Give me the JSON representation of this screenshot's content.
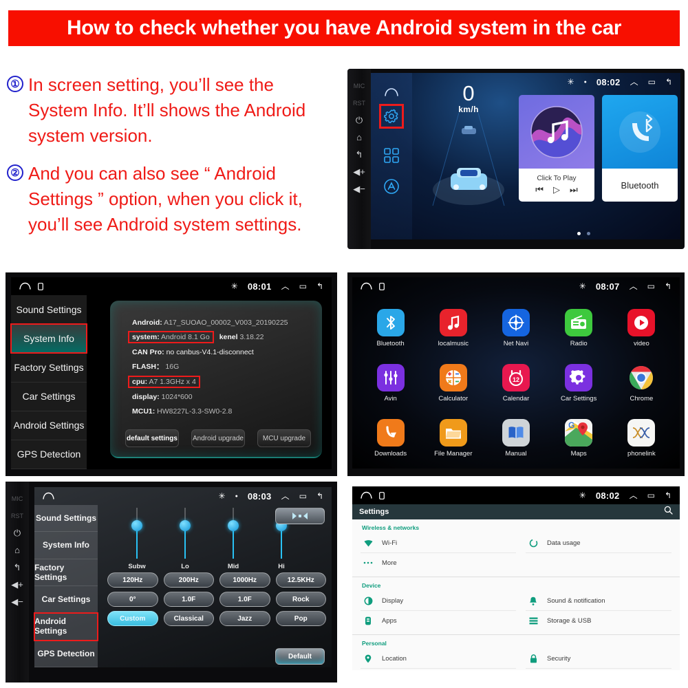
{
  "banner": {
    "title": "How to check whether you have Android system in the car"
  },
  "instructions": [
    {
      "num": "①",
      "text": "In screen setting, you’ll see the System Info. It’ll shows the Android system version."
    },
    {
      "num": "②",
      "text": "And you can also see “ Android Settings ” option, when you click it, you’ll see Android system settings."
    }
  ],
  "colors": {
    "banner_bg": "#f80f00",
    "instruction_text": "#ef1b17",
    "number_circle": "#2222cc",
    "highlight_box": "#ee1b1b",
    "accent_teal": "#0f9d7e",
    "accent_cyan": "#29c2f5"
  },
  "hardware_buttons": [
    {
      "label": "MIC",
      "type": "text"
    },
    {
      "label": "RST",
      "type": "text"
    },
    {
      "label": "⏻",
      "type": "glyph",
      "name": "power-button"
    },
    {
      "label": "⌂",
      "type": "glyph",
      "name": "home-button"
    },
    {
      "label": "↰",
      "type": "glyph",
      "name": "back-button"
    },
    {
      "label": "◀+",
      "type": "glyph",
      "name": "volume-up-button"
    },
    {
      "label": "◀−",
      "type": "glyph",
      "name": "volume-down-button"
    }
  ],
  "home_screen": {
    "status": {
      "bluetooth": "✳",
      "dot": "●",
      "clock": "08:02",
      "up": "︿",
      "recents": "▭",
      "back": "↰"
    },
    "launcher_icons": [
      "home-icon",
      "gear-icon",
      "apps-grid-icon",
      "assistant-icon"
    ],
    "gear_highlighted": true,
    "speed": {
      "value": "0",
      "unit": "km/h"
    },
    "cards": [
      {
        "name": "music",
        "label": "Click To Play",
        "controls": [
          "⏮",
          "▷",
          "⏭"
        ]
      },
      {
        "name": "bluetooth",
        "label": "Bluetooth"
      }
    ],
    "page_dots": 2,
    "active_dot": 0
  },
  "system_info": {
    "status": {
      "bluetooth": "✳",
      "clock": "08:01"
    },
    "menu": [
      {
        "label": "Sound Settings",
        "active": false,
        "highlighted": false
      },
      {
        "label": "System Info",
        "active": true,
        "highlighted": true
      },
      {
        "label": "Factory Settings",
        "active": false,
        "highlighted": false
      },
      {
        "label": "Car Settings",
        "active": false,
        "highlighted": false
      },
      {
        "label": "Android Settings",
        "active": false,
        "highlighted": false
      },
      {
        "label": "GPS Detection",
        "active": false,
        "highlighted": false
      }
    ],
    "rows": [
      {
        "key": "Android:",
        "value": "A17_SUOAO_00002_V003_20190225",
        "boxed": false
      },
      {
        "key": "system:",
        "value": "Android 8.1 Go",
        "key2": "kenel",
        "value2": "3.18.22",
        "boxed": true
      },
      {
        "key": "CAN Pro:",
        "value": "no canbus-V4.1-disconnect",
        "boxed": false
      },
      {
        "key": "FLASH：",
        "value": "16G",
        "boxed": false
      },
      {
        "key": "cpu:",
        "value": "A7 1.3GHz x 4",
        "boxed": true
      },
      {
        "key": "display:",
        "value": "1024*600",
        "boxed": false
      },
      {
        "key": "MCU1:",
        "value": "HW8227L-3.3-SW0-2.8",
        "boxed": false
      }
    ],
    "buttons": [
      {
        "label": "default settings",
        "primary": true
      },
      {
        "label": "Android upgrade",
        "primary": false
      },
      {
        "label": "MCU upgrade",
        "primary": false
      }
    ]
  },
  "app_grid": {
    "status": {
      "bluetooth": "✳",
      "dot": "●",
      "clock": "08:07"
    },
    "apps": [
      {
        "label": "Bluetooth",
        "icon": "bluetooth-icon",
        "bg": "#2aa7e8"
      },
      {
        "label": "localmusic",
        "icon": "music-note-icon",
        "bg": "#e8232c"
      },
      {
        "label": "Net Navi",
        "icon": "compass-icon",
        "bg": "#1565e0"
      },
      {
        "label": "Radio",
        "icon": "radio-icon",
        "bg": "#3ec93e"
      },
      {
        "label": "video",
        "icon": "play-circle-icon",
        "bg": "#e8122a"
      },
      {
        "label": "Avin",
        "icon": "sliders-icon",
        "bg": "#7b30e0"
      },
      {
        "label": "Calculator",
        "icon": "calculator-icon",
        "bg": "#f07a1a"
      },
      {
        "label": "Calendar",
        "icon": "calendar-icon",
        "bg": "#e8184f"
      },
      {
        "label": "Car Settings",
        "icon": "gear-icon",
        "bg": "#7b30e0"
      },
      {
        "label": "Chrome",
        "icon": "chrome-icon",
        "bg": "#ffffff"
      },
      {
        "label": "Downloads",
        "icon": "download-icon",
        "bg": "#f07a1a"
      },
      {
        "label": "File Manager",
        "icon": "folder-icon",
        "bg": "#f09a1a"
      },
      {
        "label": "Manual",
        "icon": "book-icon",
        "bg": "#cfd4d8"
      },
      {
        "label": "Maps",
        "icon": "map-pin-icon",
        "bg": "#ffffff"
      },
      {
        "label": "phonelink",
        "icon": "phonelink-icon",
        "bg": "#f4f4f4"
      }
    ]
  },
  "equalizer": {
    "status": {
      "bluetooth": "✳",
      "dot": "●",
      "clock": "08:03"
    },
    "menu": [
      {
        "label": "Sound Settings",
        "highlighted": false
      },
      {
        "label": "System Info",
        "highlighted": false
      },
      {
        "label": "Factory Settings",
        "highlighted": false
      },
      {
        "label": "Car Settings",
        "highlighted": false
      },
      {
        "label": "Android Settings",
        "highlighted": true
      },
      {
        "label": "GPS Detection",
        "highlighted": false
      }
    ],
    "sliders": [
      {
        "label": "Subw",
        "value": 62
      },
      {
        "label": "Lo",
        "value": 62
      },
      {
        "label": "Mid",
        "value": 62
      },
      {
        "label": "Hi",
        "value": 62
      }
    ],
    "buttons": [
      {
        "label": "120Hz",
        "on": false
      },
      {
        "label": "200Hz",
        "on": false
      },
      {
        "label": "1000Hz",
        "on": false
      },
      {
        "label": "12.5KHz",
        "on": false
      },
      {
        "label": "0°",
        "on": false
      },
      {
        "label": "1.0F",
        "on": false
      },
      {
        "label": "1.0F",
        "on": false
      },
      {
        "label": "Rock",
        "on": false
      },
      {
        "label": "Custom",
        "on": true
      },
      {
        "label": "Classical",
        "on": false
      },
      {
        "label": "Jazz",
        "on": false
      },
      {
        "label": "Pop",
        "on": false
      }
    ],
    "default_button": "Default",
    "balance_button": "balance-icon"
  },
  "android_settings": {
    "status": {
      "bluetooth": "✳",
      "dot": "●",
      "clock": "08:02"
    },
    "appbar": {
      "title": "Settings",
      "search": "search-icon"
    },
    "groups": [
      {
        "title": "Wireless & networks",
        "items": [
          {
            "label": "Wi-Fi",
            "icon": "wifi-icon"
          },
          {
            "label": "Data usage",
            "icon": "data-usage-icon"
          },
          {
            "label": "More",
            "icon": "more-icon"
          }
        ]
      },
      {
        "title": "Device",
        "items": [
          {
            "label": "Display",
            "icon": "brightness-icon"
          },
          {
            "label": "Sound & notification",
            "icon": "bell-icon"
          },
          {
            "label": "Apps",
            "icon": "apps-icon"
          },
          {
            "label": "Storage & USB",
            "icon": "storage-icon"
          }
        ]
      },
      {
        "title": "Personal",
        "items": [
          {
            "label": "Location",
            "icon": "location-pin-icon"
          },
          {
            "label": "Security",
            "icon": "lock-icon"
          }
        ]
      }
    ]
  }
}
